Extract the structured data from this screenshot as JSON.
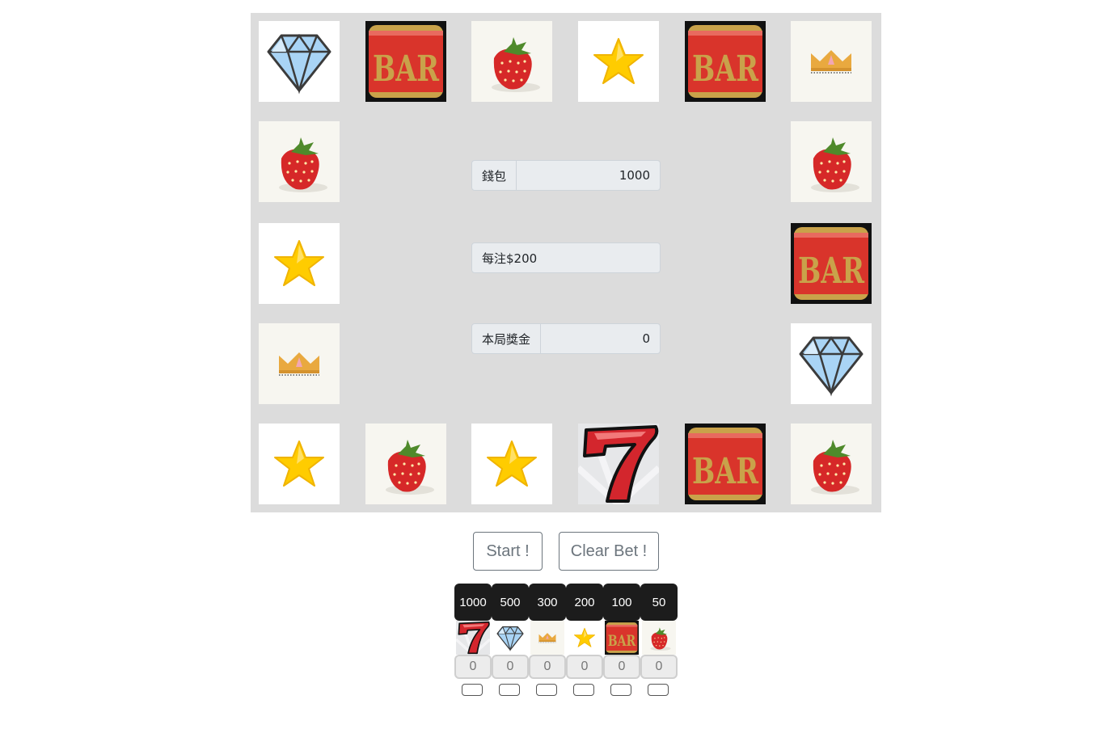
{
  "board": {
    "cells": [
      "diamond",
      "bar",
      "strawberry",
      "star",
      "bar",
      "crown",
      "strawberry",
      "strawberry",
      "star",
      "bar",
      "crown",
      "diamond",
      "star",
      "strawberry",
      "star",
      "seven",
      "bar",
      "strawberry"
    ]
  },
  "info": {
    "wallet_label": "錢包",
    "wallet_value": "1000",
    "bet_text": "每注$200",
    "prize_label": "本局獎金",
    "prize_value": "0"
  },
  "buttons": {
    "start": "Start !",
    "clear": "Clear Bet !"
  },
  "bets": [
    {
      "symbol": "seven",
      "odds": "1000",
      "count": "0"
    },
    {
      "symbol": "diamond",
      "odds": "500",
      "count": "0"
    },
    {
      "symbol": "crown",
      "odds": "300",
      "count": "0"
    },
    {
      "symbol": "star",
      "odds": "200",
      "count": "0"
    },
    {
      "symbol": "bar",
      "odds": "100",
      "count": "0"
    },
    {
      "symbol": "strawberry",
      "odds": "50",
      "count": "0"
    }
  ],
  "icon_names": {
    "seven": "seven-icon",
    "diamond": "diamond-icon",
    "crown": "crown-icon",
    "star": "star-icon",
    "bar": "bar-icon",
    "strawberry": "strawberry-icon"
  },
  "colors": {
    "board_bg": "#dcdcdc",
    "odds_bg": "#1c1c1c",
    "bar_red": "#d9342b",
    "bar_gold": "#c9a24a",
    "star_yellow": "#ffcc00",
    "strawberry_red": "#d62828",
    "diamond_blue": "#a9d4f5",
    "seven_red": "#d3262d"
  }
}
